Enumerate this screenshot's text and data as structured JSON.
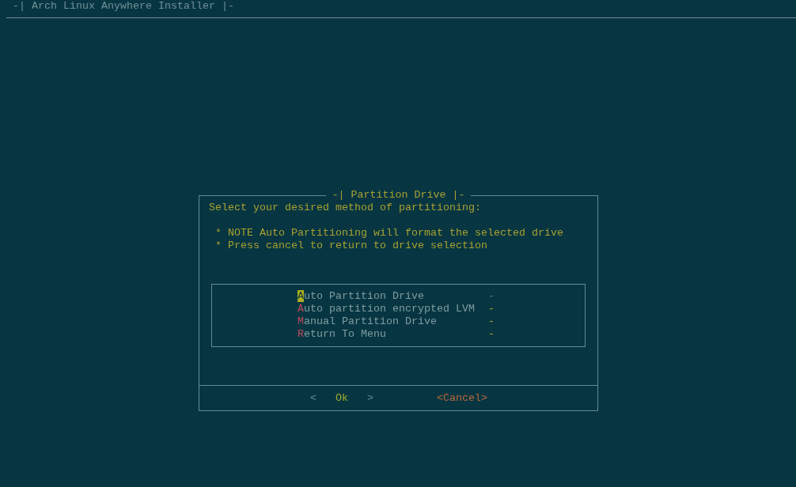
{
  "backtitle": "-| Arch Linux Anywhere Installer |-",
  "dialog": {
    "title": "-| Partition Drive |-",
    "prompt": "Select your desired method of partitioning:",
    "notes": [
      "* NOTE Auto Partitioning will format the selected drive",
      "* Press cancel to return to drive selection"
    ],
    "menu": [
      {
        "label": "Auto Partition Drive",
        "description": "-",
        "selected": true
      },
      {
        "label": "Auto partition encrypted LVM",
        "description": "-",
        "selected": false
      },
      {
        "label": "Manual Partition Drive",
        "description": "-",
        "selected": false
      },
      {
        "label": "Return To Menu",
        "description": "-",
        "selected": false
      }
    ],
    "buttons": [
      {
        "left": "<",
        "label": "Ok",
        "right": ">",
        "selected": true
      },
      {
        "left": "<",
        "label": "Cancel",
        "right": ">",
        "selected": false
      }
    ]
  }
}
